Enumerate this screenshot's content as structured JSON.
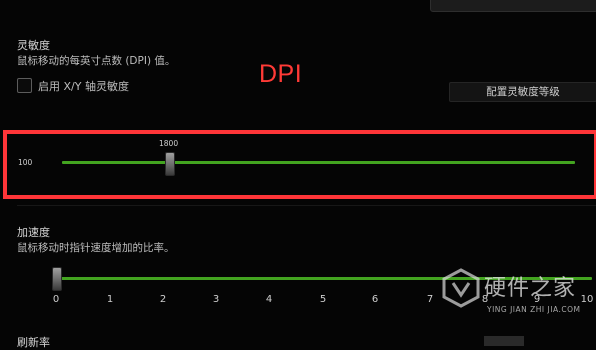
{
  "sensitivity": {
    "title": "灵敏度",
    "description": "鼠标移动的每英寸点数 (DPI) 值。",
    "enable_xy_label": "启用 X/Y 轴灵敏度",
    "enable_xy_checked": false,
    "config_button_label": "配置灵敏度等级",
    "min_label": "100",
    "value_label": "1800",
    "value": 1800
  },
  "annotation": {
    "text": "DPI",
    "color": "#ff3a36"
  },
  "acceleration": {
    "title": "加速度",
    "description": "鼠标移动时指针速度增加的比率。",
    "ticks": [
      "0",
      "1",
      "2",
      "3",
      "4",
      "5",
      "6",
      "7",
      "8",
      "9",
      "10"
    ],
    "value": 0
  },
  "polling": {
    "title": "刷新率"
  },
  "watermark": {
    "title": "硬件之家",
    "subtitle": "YING JIAN ZHI JIA.COM"
  },
  "colors": {
    "accent_green": "#43a420",
    "highlight_red": "#ff3538"
  }
}
